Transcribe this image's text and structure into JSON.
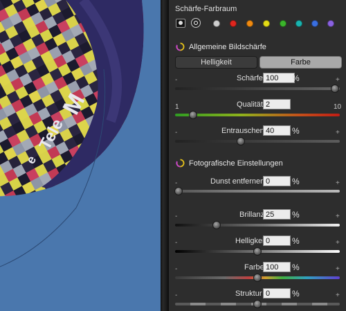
{
  "panel": {
    "color_space_title": "Schärfe-Farbraum",
    "color_dots": [
      "#cfcfcf",
      "#e0261e",
      "#f08a10",
      "#e4dc16",
      "#3bb52b",
      "#19b4b0",
      "#3a6fe0",
      "#8a62e0"
    ],
    "section_general": "Allgemeine Bildschärfe",
    "tab_brightness": "Helligkeit",
    "tab_color": "Farbe",
    "sharpness": {
      "label": "Schärfe",
      "value": "100",
      "unit": "%",
      "minus": "-",
      "plus": "+",
      "level": 0.97
    },
    "quality": {
      "label": "Qualität",
      "value": "2",
      "min_label": "1",
      "max_label": "10",
      "level": 0.11
    },
    "noise": {
      "label": "Entrauschen",
      "value": "40",
      "unit": "%",
      "minus": "-",
      "plus": "+",
      "level": 0.4
    },
    "section_photo": "Fotografische Einstellungen",
    "haze": {
      "label": "Dunst entfernen",
      "value": "0",
      "unit": "%",
      "minus": "-",
      "plus": "+",
      "level": 0.02
    },
    "brilliance": {
      "label": "Brillanz",
      "value": "25",
      "unit": "%",
      "minus": "-",
      "plus": "+",
      "level": 0.25
    },
    "brightness": {
      "label": "Helligkeit",
      "value": "0",
      "unit": "%",
      "minus": "-",
      "plus": "+",
      "level": 0.5
    },
    "color": {
      "label": "Farbe",
      "value": "100",
      "unit": "%",
      "minus": "-",
      "plus": "+",
      "level": 0.5
    },
    "structure": {
      "label": "Struktur",
      "value": "0",
      "unit": "%",
      "minus": "-",
      "plus": "+",
      "level": 0.5
    }
  }
}
